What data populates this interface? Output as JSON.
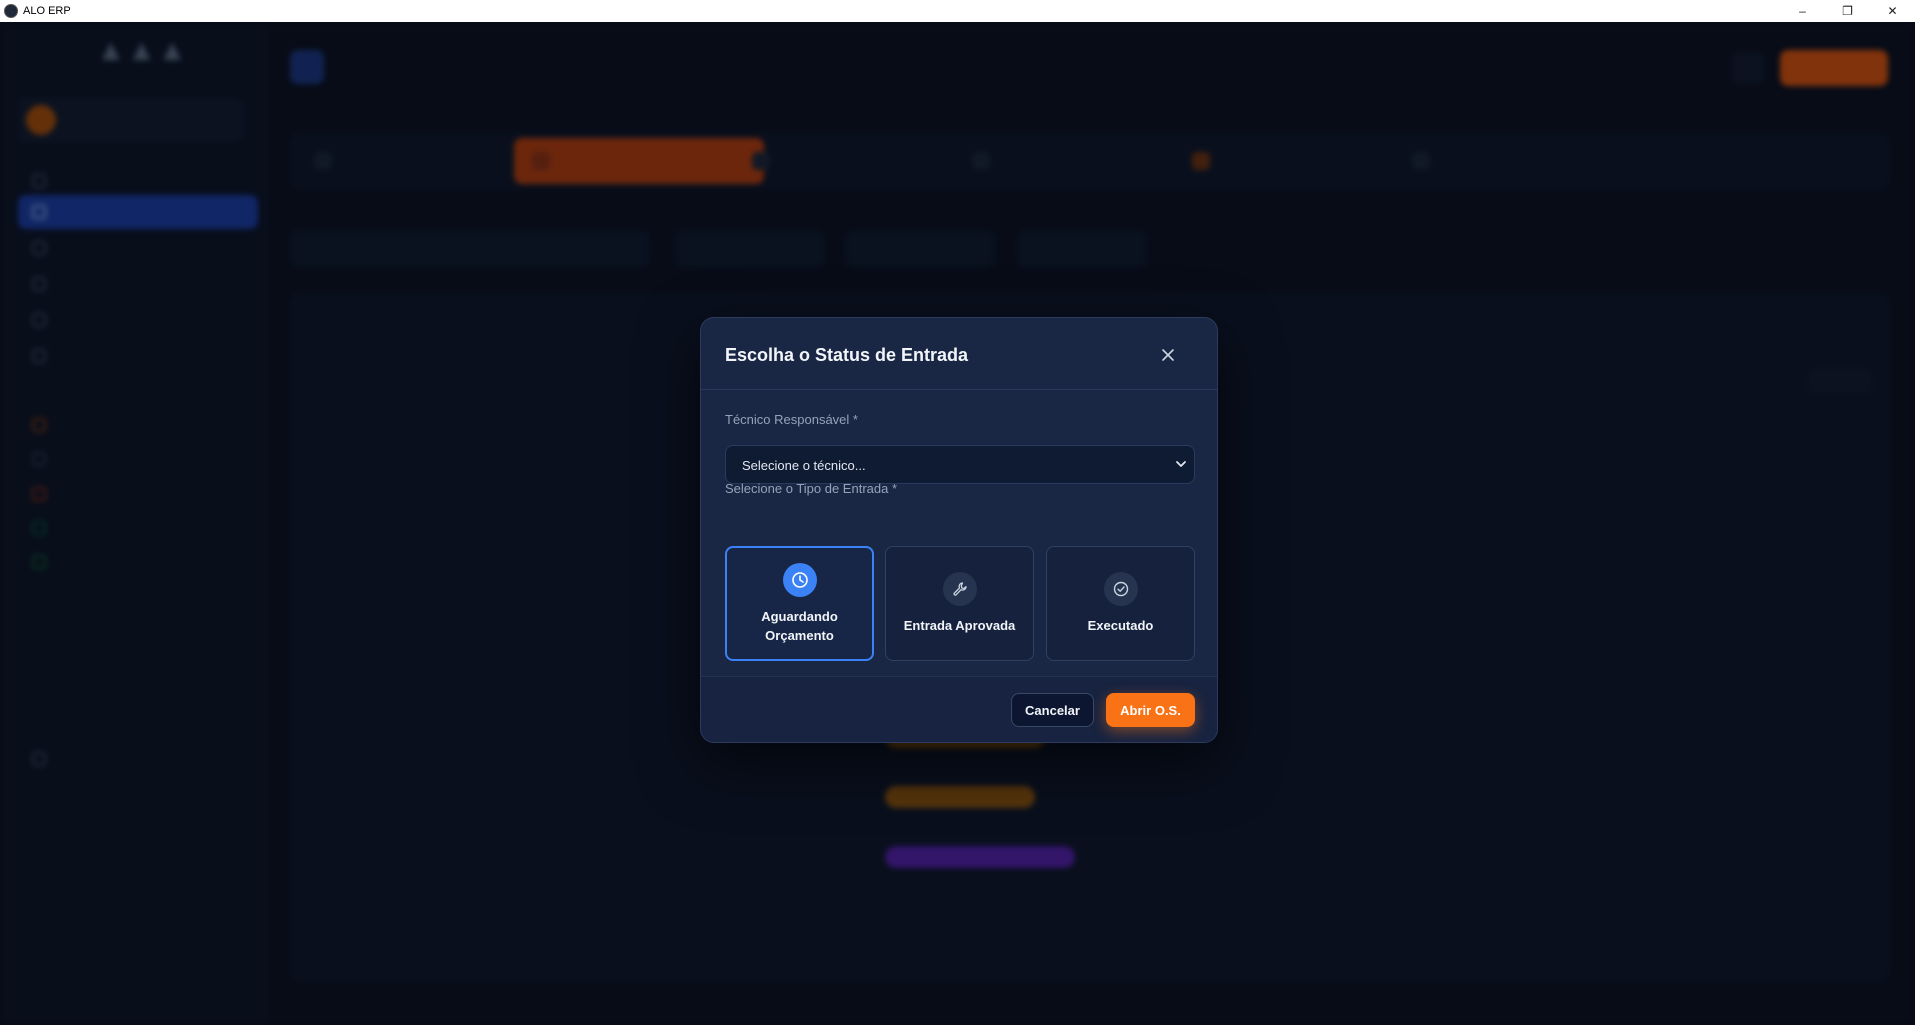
{
  "window": {
    "title": "ALO ERP",
    "minimize": "–",
    "maximize": "❐",
    "close": "✕"
  },
  "modal": {
    "title": "Escolha o Status de Entrada",
    "technician_label": "Técnico Responsável *",
    "technician_placeholder": "Selecione o técnico...",
    "entry_type_label": "Selecione o Tipo de Entrada *",
    "options": [
      {
        "label": "Aguardando Orçamento",
        "icon": "clock-icon",
        "selected": true
      },
      {
        "label": "Entrada Aprovada",
        "icon": "wrench-icon",
        "selected": false
      },
      {
        "label": "Executado",
        "icon": "check-circle-icon",
        "selected": false
      }
    ],
    "cancel_label": "Cancelar",
    "submit_label": "Abrir O.S.",
    "colors": {
      "accent": "#3b82f6",
      "primary_action": "#f97316",
      "background": "#1a2744"
    }
  }
}
